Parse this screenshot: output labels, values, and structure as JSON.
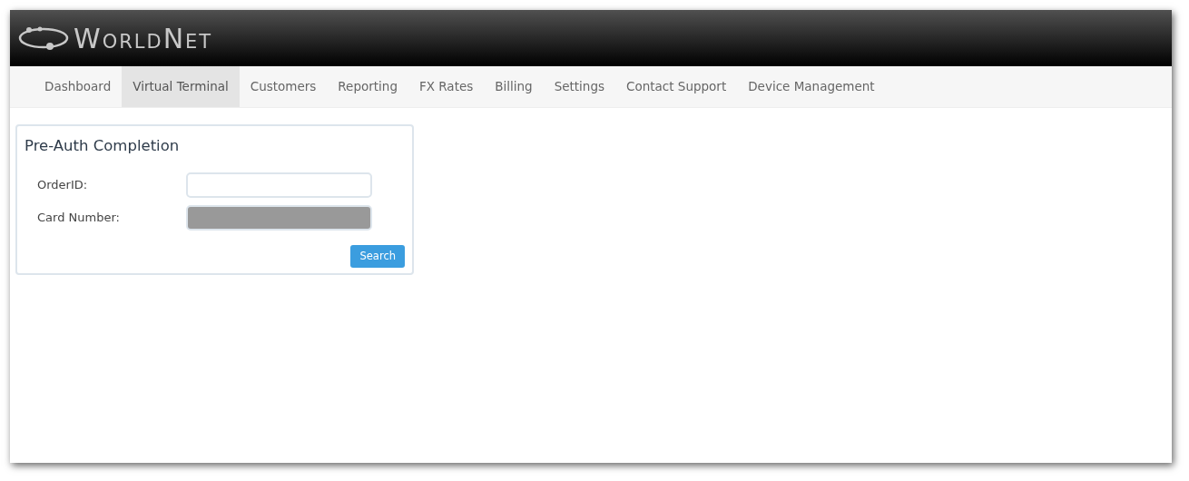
{
  "logo": {
    "text": "WorldNet"
  },
  "nav": [
    {
      "label": "Dashboard",
      "selected": false
    },
    {
      "label": "Virtual Terminal",
      "selected": true
    },
    {
      "label": "Customers",
      "selected": false
    },
    {
      "label": "Reporting",
      "selected": false
    },
    {
      "label": "FX Rates",
      "selected": false
    },
    {
      "label": "Billing",
      "selected": false
    },
    {
      "label": "Settings",
      "selected": false
    },
    {
      "label": "Contact Support",
      "selected": false
    },
    {
      "label": "Device Management",
      "selected": false
    }
  ],
  "panel": {
    "title": "Pre-Auth Completion",
    "fields": [
      {
        "label": "OrderID:",
        "disabled": false
      },
      {
        "label": "Card Number:",
        "disabled": true
      }
    ],
    "button": "Search"
  }
}
